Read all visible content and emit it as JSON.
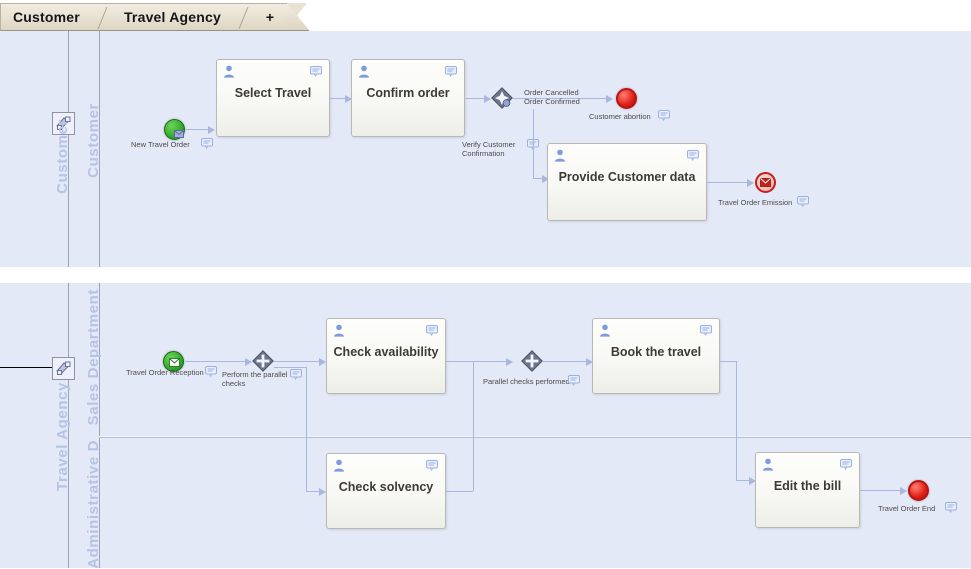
{
  "app": {
    "tabs": [
      {
        "label": "Customer",
        "name": "tab-customer",
        "active": true
      },
      {
        "label": "Travel Agency",
        "name": "tab-travel-agency",
        "active": true
      }
    ],
    "add_tab_label": "+"
  },
  "colors": {
    "canvas": "#e4e9f8",
    "pool_label": "#b7c3e6",
    "flow": "#a9b6dd",
    "task_border": "#b9b9b4",
    "start_event": "#33ab2c",
    "end_event": "#e01f16",
    "tab_bar": "#e8e1d1"
  },
  "pools": [
    {
      "name": "pool-customer",
      "label": "Customer",
      "lanes": [
        {
          "label": "Customer",
          "name": "lane-customer"
        }
      ],
      "icon": "pool-collapse-icon"
    },
    {
      "name": "pool-travel-agency",
      "label": "Travel Agency",
      "lanes": [
        {
          "label": "Sales Department",
          "name": "lane-sales-department"
        },
        {
          "label": "Administrative D",
          "name": "lane-administrative-department"
        }
      ],
      "icon": "pool-collapse-icon"
    }
  ],
  "diagram": {
    "events": [
      {
        "id": "new-travel-order",
        "label": "New Travel Order",
        "type": "start-message",
        "pool": "customer"
      },
      {
        "id": "customer-abortion",
        "label": "Customer abortion",
        "type": "end-terminate",
        "pool": "customer"
      },
      {
        "id": "travel-order-emission",
        "label": "Travel Order Emission",
        "type": "end-message",
        "pool": "customer"
      },
      {
        "id": "travel-order-reception",
        "label": "Travel Order Reception",
        "type": "start-message",
        "pool": "travel-agency"
      },
      {
        "id": "travel-order-end",
        "label": "Travel Order End",
        "type": "end-terminate",
        "pool": "travel-agency"
      }
    ],
    "tasks": [
      {
        "id": "select-travel",
        "label": "Select Travel",
        "type": "user-task",
        "pool": "customer"
      },
      {
        "id": "confirm-order",
        "label": "Confirm order",
        "type": "user-task",
        "pool": "customer"
      },
      {
        "id": "provide-customer-data",
        "label": "Provide Customer data",
        "type": "user-task",
        "pool": "customer"
      },
      {
        "id": "check-availability",
        "label": "Check availability",
        "type": "user-task",
        "pool": "travel-agency"
      },
      {
        "id": "check-solvency",
        "label": "Check solvency",
        "type": "user-task",
        "pool": "travel-agency"
      },
      {
        "id": "book-the-travel",
        "label": "Book the travel",
        "type": "user-task",
        "pool": "travel-agency"
      },
      {
        "id": "edit-the-bill",
        "label": "Edit the bill",
        "type": "user-task",
        "pool": "travel-agency"
      }
    ],
    "gateways": [
      {
        "id": "verify-customer-confirmation",
        "label": "Verify Customer Confirmation",
        "type": "event-based",
        "pool": "customer"
      },
      {
        "id": "perform-the-parallel-checks",
        "label": "Perform the parallel checks",
        "type": "parallel-split",
        "pool": "travel-agency"
      },
      {
        "id": "parallel-checks-performed",
        "label": "Parallel checks performed",
        "type": "parallel-join",
        "pool": "travel-agency"
      }
    ],
    "flow_labels": [
      {
        "id": "order-cancelled",
        "label": "Order Cancelled"
      },
      {
        "id": "order-confirmed",
        "label": "Order Confirmed"
      }
    ]
  }
}
